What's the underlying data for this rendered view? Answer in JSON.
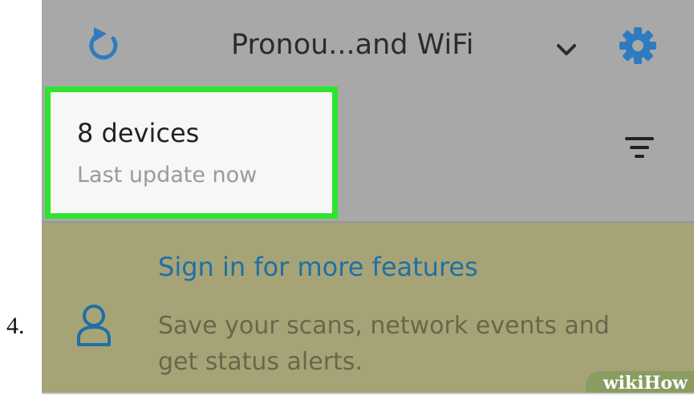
{
  "step": {
    "number": "4."
  },
  "header": {
    "network_name": "Pronou...and WiFi",
    "icons": {
      "refresh": "refresh-icon",
      "dropdown": "chevron-down-icon",
      "settings": "gear-icon"
    },
    "accent_color": "#2f7bbf"
  },
  "devices": {
    "count_label": "8 devices",
    "last_update": "Last update now",
    "highlight_color": "#2ee52e",
    "filter_icon": "filter-icon"
  },
  "banner": {
    "title": "Sign in for more features",
    "body": "Save your scans, network events and get status alerts.",
    "icon": "user-icon",
    "title_color": "#1f6fa6"
  },
  "watermark": {
    "brand": "wikiHow"
  }
}
